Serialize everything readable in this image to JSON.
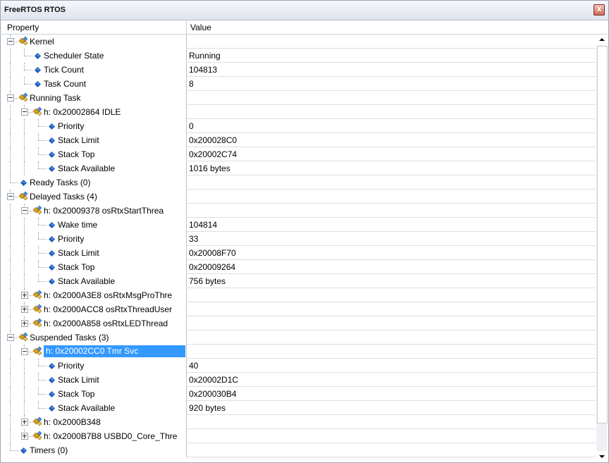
{
  "window": {
    "title": "FreeRTOS RTOS",
    "close_label": "x"
  },
  "header": {
    "property": "Property",
    "value": "Value"
  },
  "rows": [
    {
      "label": "Kernel",
      "value": "",
      "kind": "group",
      "expander": "minus"
    },
    {
      "label": "Scheduler State",
      "value": "Running",
      "kind": "leaf"
    },
    {
      "label": "Tick Count",
      "value": "104813",
      "kind": "leaf"
    },
    {
      "label": "Task Count",
      "value": "8",
      "kind": "leaf"
    },
    {
      "label": "Running Task",
      "value": "",
      "kind": "group",
      "expander": "minus"
    },
    {
      "label": "h: 0x20002864 IDLE",
      "value": "",
      "kind": "group",
      "expander": "minus"
    },
    {
      "label": "Priority",
      "value": "0",
      "kind": "leaf"
    },
    {
      "label": "Stack Limit",
      "value": "0x200028C0",
      "kind": "leaf"
    },
    {
      "label": "Stack Top",
      "value": "0x20002C74",
      "kind": "leaf"
    },
    {
      "label": "Stack Available",
      "value": "1016 bytes",
      "kind": "leaf"
    },
    {
      "label": "Ready Tasks (0)",
      "value": "",
      "kind": "leaf"
    },
    {
      "label": "Delayed Tasks (4)",
      "value": "",
      "kind": "group",
      "expander": "minus"
    },
    {
      "label": "h: 0x20009378 osRtxStartThrea",
      "value": "",
      "kind": "group",
      "expander": "minus"
    },
    {
      "label": "Wake time",
      "value": "104814",
      "kind": "leaf"
    },
    {
      "label": "Priority",
      "value": "33",
      "kind": "leaf"
    },
    {
      "label": "Stack Limit",
      "value": "0x20008F70",
      "kind": "leaf"
    },
    {
      "label": "Stack Top",
      "value": "0x20009264",
      "kind": "leaf"
    },
    {
      "label": "Stack Available",
      "value": "756 bytes",
      "kind": "leaf"
    },
    {
      "label": "h: 0x2000A3E8 osRtxMsgProThre",
      "value": "",
      "kind": "group",
      "expander": "plus"
    },
    {
      "label": "h: 0x2000ACC8 osRtxThreadUser",
      "value": "",
      "kind": "group",
      "expander": "plus"
    },
    {
      "label": "h: 0x2000A858 osRtxLEDThread",
      "value": "",
      "kind": "group",
      "expander": "plus"
    },
    {
      "label": "Suspended Tasks (3)",
      "value": "",
      "kind": "group",
      "expander": "minus"
    },
    {
      "label": "h: 0x20002CC0 Tmr Svc",
      "value": "",
      "kind": "group",
      "expander": "minus",
      "selected": true
    },
    {
      "label": "Priority",
      "value": "40",
      "kind": "leaf"
    },
    {
      "label": "Stack Limit",
      "value": "0x20002D1C",
      "kind": "leaf"
    },
    {
      "label": "Stack Top",
      "value": "0x200030B4",
      "kind": "leaf"
    },
    {
      "label": "Stack Available",
      "value": "920 bytes",
      "kind": "leaf"
    },
    {
      "label": "h: 0x2000B348",
      "value": "",
      "kind": "group",
      "expander": "plus"
    },
    {
      "label": "h: 0x2000B7B8 USBD0_Core_Thre",
      "value": "",
      "kind": "group",
      "expander": "plus"
    },
    {
      "label": "Timers (0)",
      "value": "",
      "kind": "leaf"
    }
  ],
  "icons": {
    "leaf": "diamond-icon",
    "group": "property-group-icon",
    "accent": "#3399ff"
  }
}
